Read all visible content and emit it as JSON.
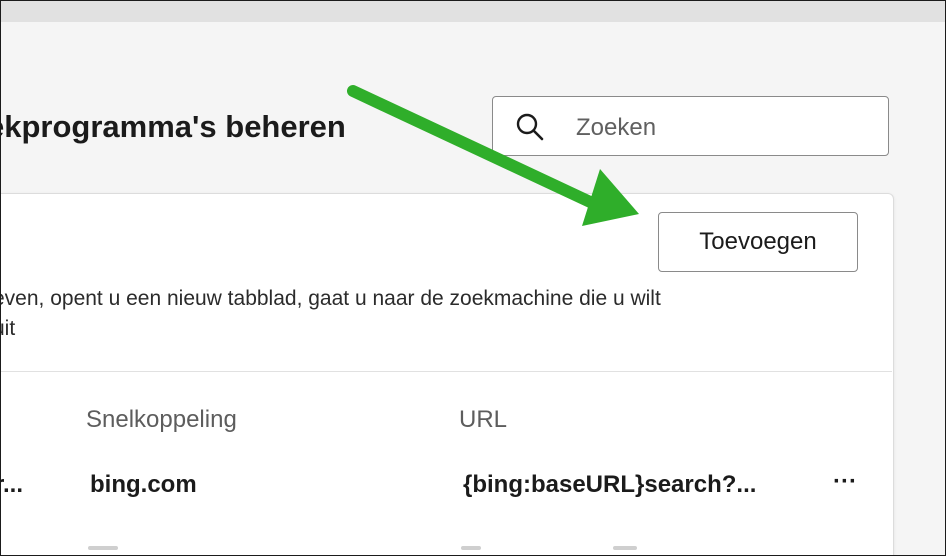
{
  "page": {
    "title": "ekprogramma's beheren"
  },
  "search": {
    "placeholder": "Zoeken",
    "icon": "search-icon"
  },
  "card": {
    "add_button_label": "Toevoegen",
    "description_line1": "even, opent u een nieuw tabblad, gaat u naar de zoekmachine die u wilt",
    "description_line2": "uit"
  },
  "table": {
    "columns": [
      "Snelkoppeling",
      "URL"
    ],
    "rows": [
      {
        "name": "r...",
        "shortcut": "bing.com",
        "url": "{bing:baseURL}search?...",
        "more_label": "···"
      }
    ]
  },
  "annotation": {
    "arrow_color": "#2fae2a",
    "arrow_target": "add-button"
  }
}
